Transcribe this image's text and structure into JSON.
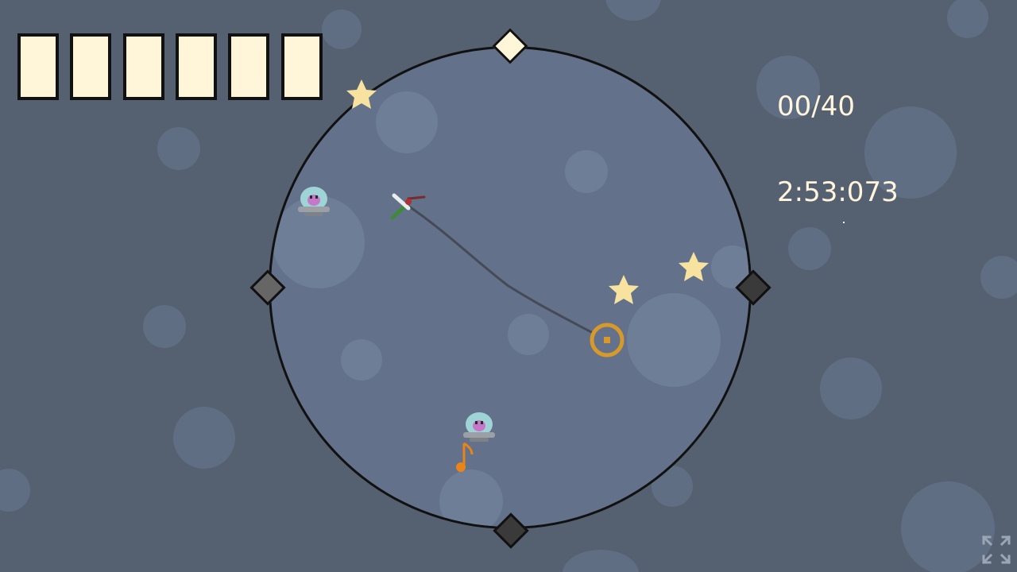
{
  "hud": {
    "collected_counter": "00/40",
    "timer": "2:53:073",
    "health_slots": [
      1,
      1,
      1,
      1,
      1,
      1
    ]
  },
  "colors": {
    "background": "#556070",
    "arena_fill": "#63718a",
    "arena_outline": "#111111",
    "health_fill": "#fff5d8",
    "star": "#f7e2a0",
    "target_ring": "#d79a2a",
    "gate_active": "#fff5d8",
    "gate_left": "#666666",
    "gate_inactive": "#3a3a3a",
    "hud_text": "#fff5dc",
    "note": "#e98418"
  },
  "entities": {
    "stars": 3,
    "ufo_enemies": 2,
    "gates": [
      "top-active",
      "left-grey",
      "right-dark",
      "bottom-dark"
    ],
    "player_icon": "hummingbird-icon",
    "target_icon": "target-ring-icon",
    "note_icon": "music-note-icon"
  }
}
